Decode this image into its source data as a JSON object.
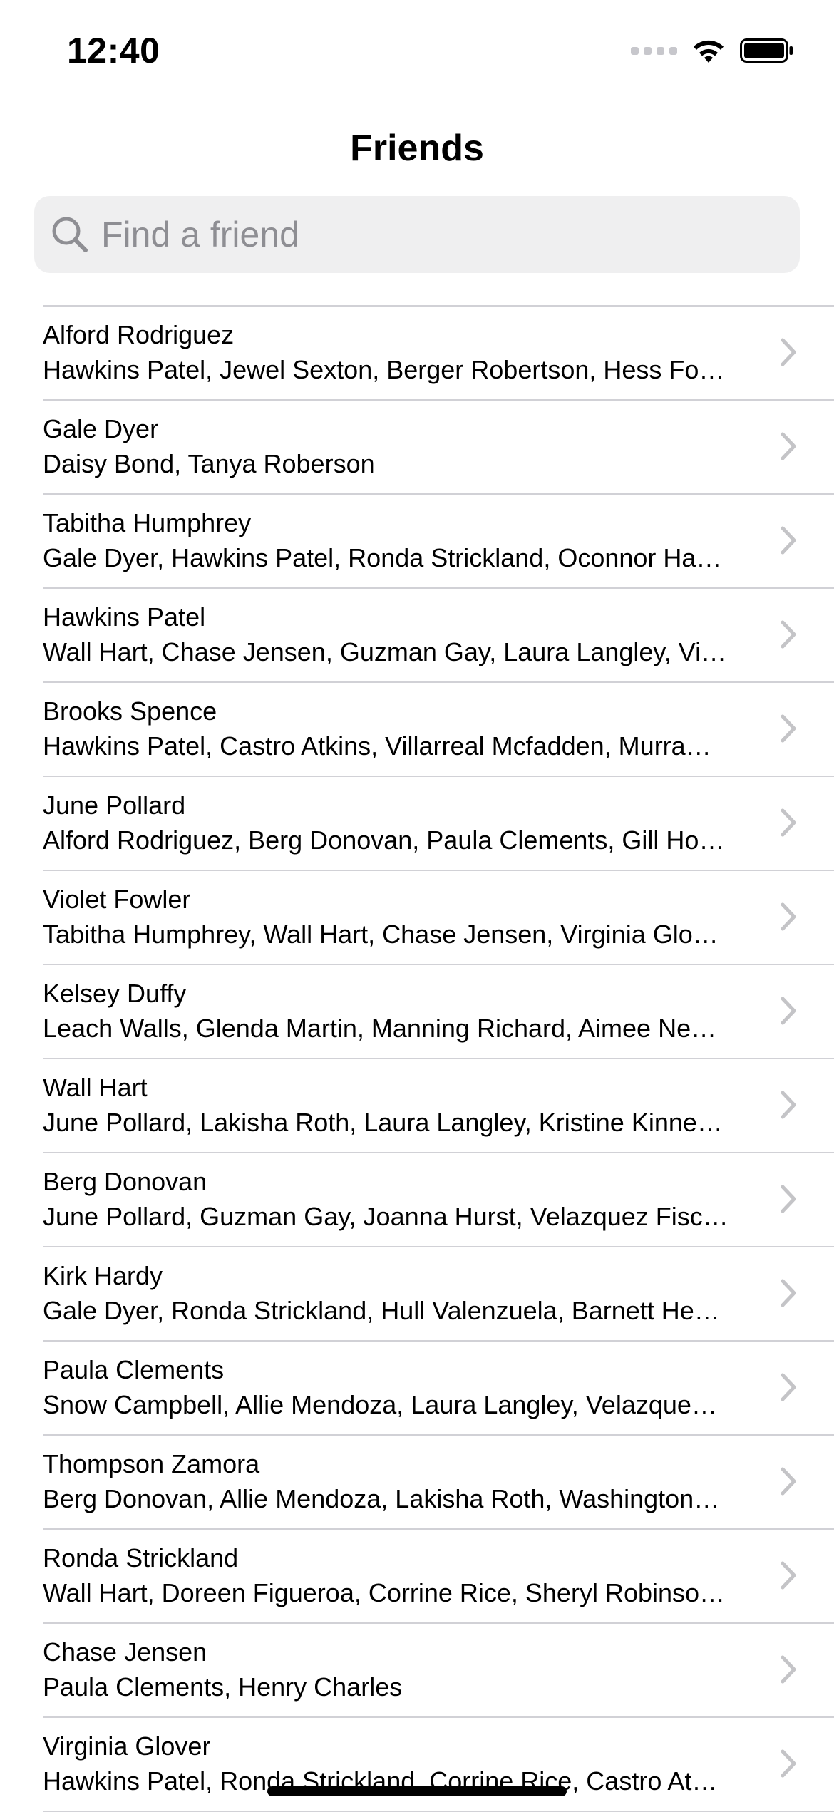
{
  "status_bar": {
    "time": "12:40",
    "icons": [
      "cellular-signal-icon",
      "wifi-icon",
      "battery-icon"
    ]
  },
  "nav": {
    "title": "Friends"
  },
  "search": {
    "placeholder": "Find a friend",
    "value": ""
  },
  "friends": [
    {
      "name": "Alford Rodriguez",
      "mutuals": "Hawkins Patel, Jewel Sexton, Berger Robertson, Hess Fo…"
    },
    {
      "name": "Gale Dyer",
      "mutuals": "Daisy Bond, Tanya Roberson"
    },
    {
      "name": "Tabitha Humphrey",
      "mutuals": "Gale Dyer, Hawkins Patel, Ronda Strickland, Oconnor Ha…"
    },
    {
      "name": "Hawkins Patel",
      "mutuals": "Wall Hart, Chase Jensen, Guzman Gay, Laura Langley, Vi…"
    },
    {
      "name": "Brooks Spence",
      "mutuals": "Hawkins Patel, Castro Atkins, Villarreal Mcfadden, Murra…"
    },
    {
      "name": "June Pollard",
      "mutuals": "Alford Rodriguez, Berg Donovan, Paula Clements, Gill Ho…"
    },
    {
      "name": "Violet Fowler",
      "mutuals": "Tabitha Humphrey, Wall Hart, Chase Jensen, Virginia Glo…"
    },
    {
      "name": "Kelsey Duffy",
      "mutuals": "Leach Walls, Glenda Martin, Manning Richard, Aimee Ne…"
    },
    {
      "name": "Wall Hart",
      "mutuals": "June Pollard, Lakisha Roth, Laura Langley, Kristine Kinne…"
    },
    {
      "name": "Berg Donovan",
      "mutuals": "June Pollard, Guzman Gay, Joanna Hurst, Velazquez Fisc…"
    },
    {
      "name": "Kirk Hardy",
      "mutuals": "Gale Dyer, Ronda Strickland, Hull Valenzuela, Barnett He…"
    },
    {
      "name": "Paula Clements",
      "mutuals": "Snow Campbell, Allie Mendoza, Laura Langley, Velazque…"
    },
    {
      "name": "Thompson Zamora",
      "mutuals": "Berg Donovan, Allie Mendoza, Lakisha Roth, Washington…"
    },
    {
      "name": "Ronda Strickland",
      "mutuals": "Wall Hart, Doreen Figueroa, Corrine Rice, Sheryl Robinso…"
    },
    {
      "name": "Chase Jensen",
      "mutuals": "Paula Clements, Henry Charles"
    },
    {
      "name": "Virginia Glover",
      "mutuals": "Hawkins Patel, Ronda Strickland, Corrine Rice, Castro At…"
    }
  ],
  "colors": {
    "separator": "#d1d1d6",
    "search_background": "#efeff0",
    "placeholder": "#8e8e93",
    "chevron": "#c4c4c7"
  }
}
